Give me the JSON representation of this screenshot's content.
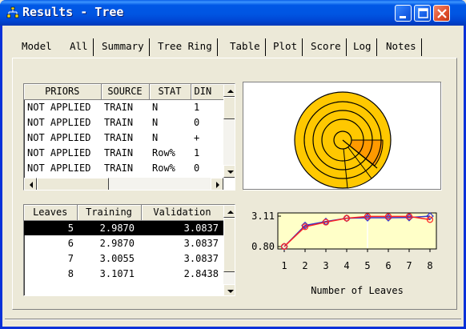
{
  "window": {
    "title": "Results - Tree",
    "buttons": [
      "minimize-icon",
      "maximize-icon",
      "close-icon"
    ]
  },
  "tabs": [
    {
      "label": "Model"
    },
    {
      "label": "All"
    },
    {
      "label": "Summary"
    },
    {
      "label": "Tree Ring"
    },
    {
      "label": "Table"
    },
    {
      "label": "Plot"
    },
    {
      "label": "Score"
    },
    {
      "label": "Log"
    },
    {
      "label": "Notes"
    }
  ],
  "active_tab": "All",
  "summary_table": {
    "headers": [
      "PRIORS",
      "SOURCE",
      "STAT",
      "DIN"
    ],
    "rows": [
      [
        "NOT APPLIED",
        "TRAIN",
        "N",
        "1"
      ],
      [
        "NOT APPLIED",
        "TRAIN",
        "N",
        "0"
      ],
      [
        "NOT APPLIED",
        "TRAIN",
        "N",
        "+"
      ],
      [
        "NOT APPLIED",
        "TRAIN",
        "Row%",
        "1"
      ],
      [
        "NOT APPLIED",
        "TRAIN",
        "Row%",
        "0"
      ]
    ]
  },
  "leaves_table": {
    "headers": [
      "Leaves",
      "Training",
      "Validation"
    ],
    "rows": [
      [
        "5",
        "2.9870",
        "3.0837"
      ],
      [
        "6",
        "2.9870",
        "3.0837"
      ],
      [
        "7",
        "3.0055",
        "3.0837"
      ],
      [
        "8",
        "3.1071",
        "2.8438"
      ]
    ],
    "selected_row": 0
  },
  "colors": {
    "titlebar": "#0054e3",
    "ring_fill": "#ffc800",
    "ring_highlight": "#ff9900",
    "training_line": "#3333cc",
    "validation_line": "#ff2222",
    "plot_bg": "#ffffc8"
  },
  "chart_data": {
    "type": "line",
    "x": [
      1,
      2,
      3,
      4,
      5,
      6,
      7,
      8
    ],
    "series": [
      {
        "values": [
          0.8,
          2.4,
          2.7,
          2.95,
          2.987,
          2.987,
          3.0055,
          3.1071
        ],
        "color": "#3333cc",
        "marker": "diamond"
      },
      {
        "values": [
          0.8,
          2.3,
          2.65,
          2.95,
          3.0837,
          3.0837,
          3.0837,
          2.8438
        ],
        "color": "#ff2222",
        "marker": "circle"
      }
    ],
    "yticks": [
      "3.11",
      "0.80"
    ],
    "ylim": [
      0.8,
      3.11
    ],
    "xticks": [
      "1",
      "2",
      "3",
      "4",
      "5",
      "6",
      "7",
      "8"
    ],
    "xlim": [
      1,
      8
    ],
    "xlabel": "Number of Leaves",
    "reference_line_x": 5
  }
}
